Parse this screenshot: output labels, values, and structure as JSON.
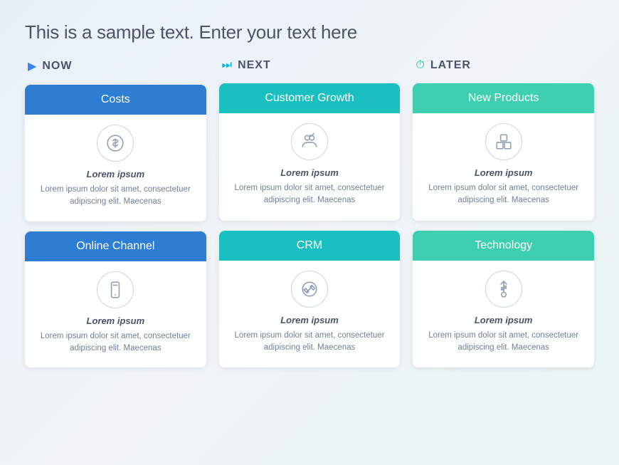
{
  "title": "This is a sample text. Enter your text here",
  "columns": [
    {
      "id": "now",
      "icon": "▶",
      "label": "NOW",
      "iconClass": "now-icon",
      "cards": [
        {
          "id": "costs",
          "header": "Costs",
          "headerClass": "blue",
          "iconType": "dollar",
          "subtitle": "Lorem ipsum",
          "text": "Lorem ipsum dolor sit amet, consectetuer adipiscing elit. Maecenas"
        },
        {
          "id": "online-channel",
          "header": "Online Channel",
          "headerClass": "blue",
          "iconType": "mobile",
          "subtitle": "Lorem ipsum",
          "text": "Lorem ipsum dolor sit amet, consectetuer adipiscing elit. Maecenas"
        }
      ]
    },
    {
      "id": "next",
      "icon": "⏭",
      "label": "NEXT",
      "iconClass": "next-icon",
      "cards": [
        {
          "id": "customer-growth",
          "header": "Customer Growth",
          "headerClass": "teal",
          "iconType": "people",
          "subtitle": "Lorem ipsum",
          "text": "Lorem ipsum dolor sit amet, consectetuer adipiscing elit. Maecenas"
        },
        {
          "id": "crm",
          "header": "CRM",
          "headerClass": "teal",
          "iconType": "handshake",
          "subtitle": "Lorem ipsum",
          "text": "Lorem ipsum dolor sit amet, consectetuer adipiscing elit. Maecenas"
        }
      ]
    },
    {
      "id": "later",
      "icon": "⏰",
      "label": "LATER",
      "iconClass": "later-icon",
      "cards": [
        {
          "id": "new-products",
          "header": "New Products",
          "headerClass": "green",
          "iconType": "boxes",
          "subtitle": "Lorem ipsum",
          "text": "Lorem ipsum dolor sit amet, consectetuer adipiscing elit. Maecenas"
        },
        {
          "id": "technology",
          "header": "Technology",
          "headerClass": "green",
          "iconType": "usb",
          "subtitle": "Lorem ipsum",
          "text": "Lorem ipsum dolor sit amet, consectetuer adipiscing elit. Maecenas"
        }
      ]
    }
  ]
}
